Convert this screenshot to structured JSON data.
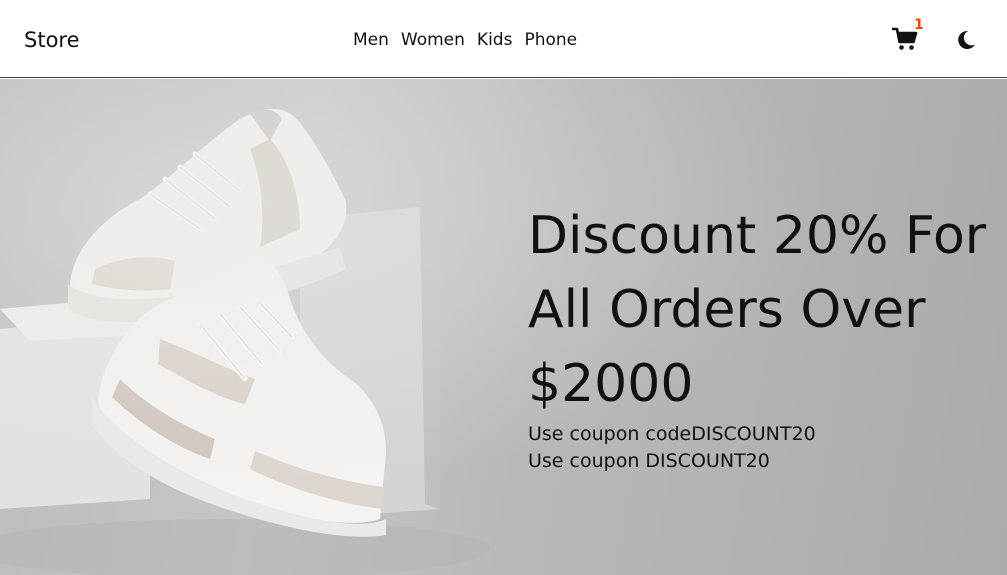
{
  "navbar": {
    "brand": "Store",
    "links": [
      "Men",
      "Women",
      "Kids",
      "Phone"
    ],
    "cart_count": "1",
    "cart_icon": "cart-icon",
    "theme_icon": "moon-icon"
  },
  "hero": {
    "title_lines": [
      "Discount 20% For",
      "All Orders Over",
      "$2000"
    ],
    "coupon_line_1": "Use coupon codeDISCOUNT20",
    "coupon_line_2": "Use coupon DISCOUNT20",
    "image": "sneakers-on-blocks-image"
  },
  "colors": {
    "badge": "#ff4500",
    "hero_overlay": "#b9b8b7"
  }
}
